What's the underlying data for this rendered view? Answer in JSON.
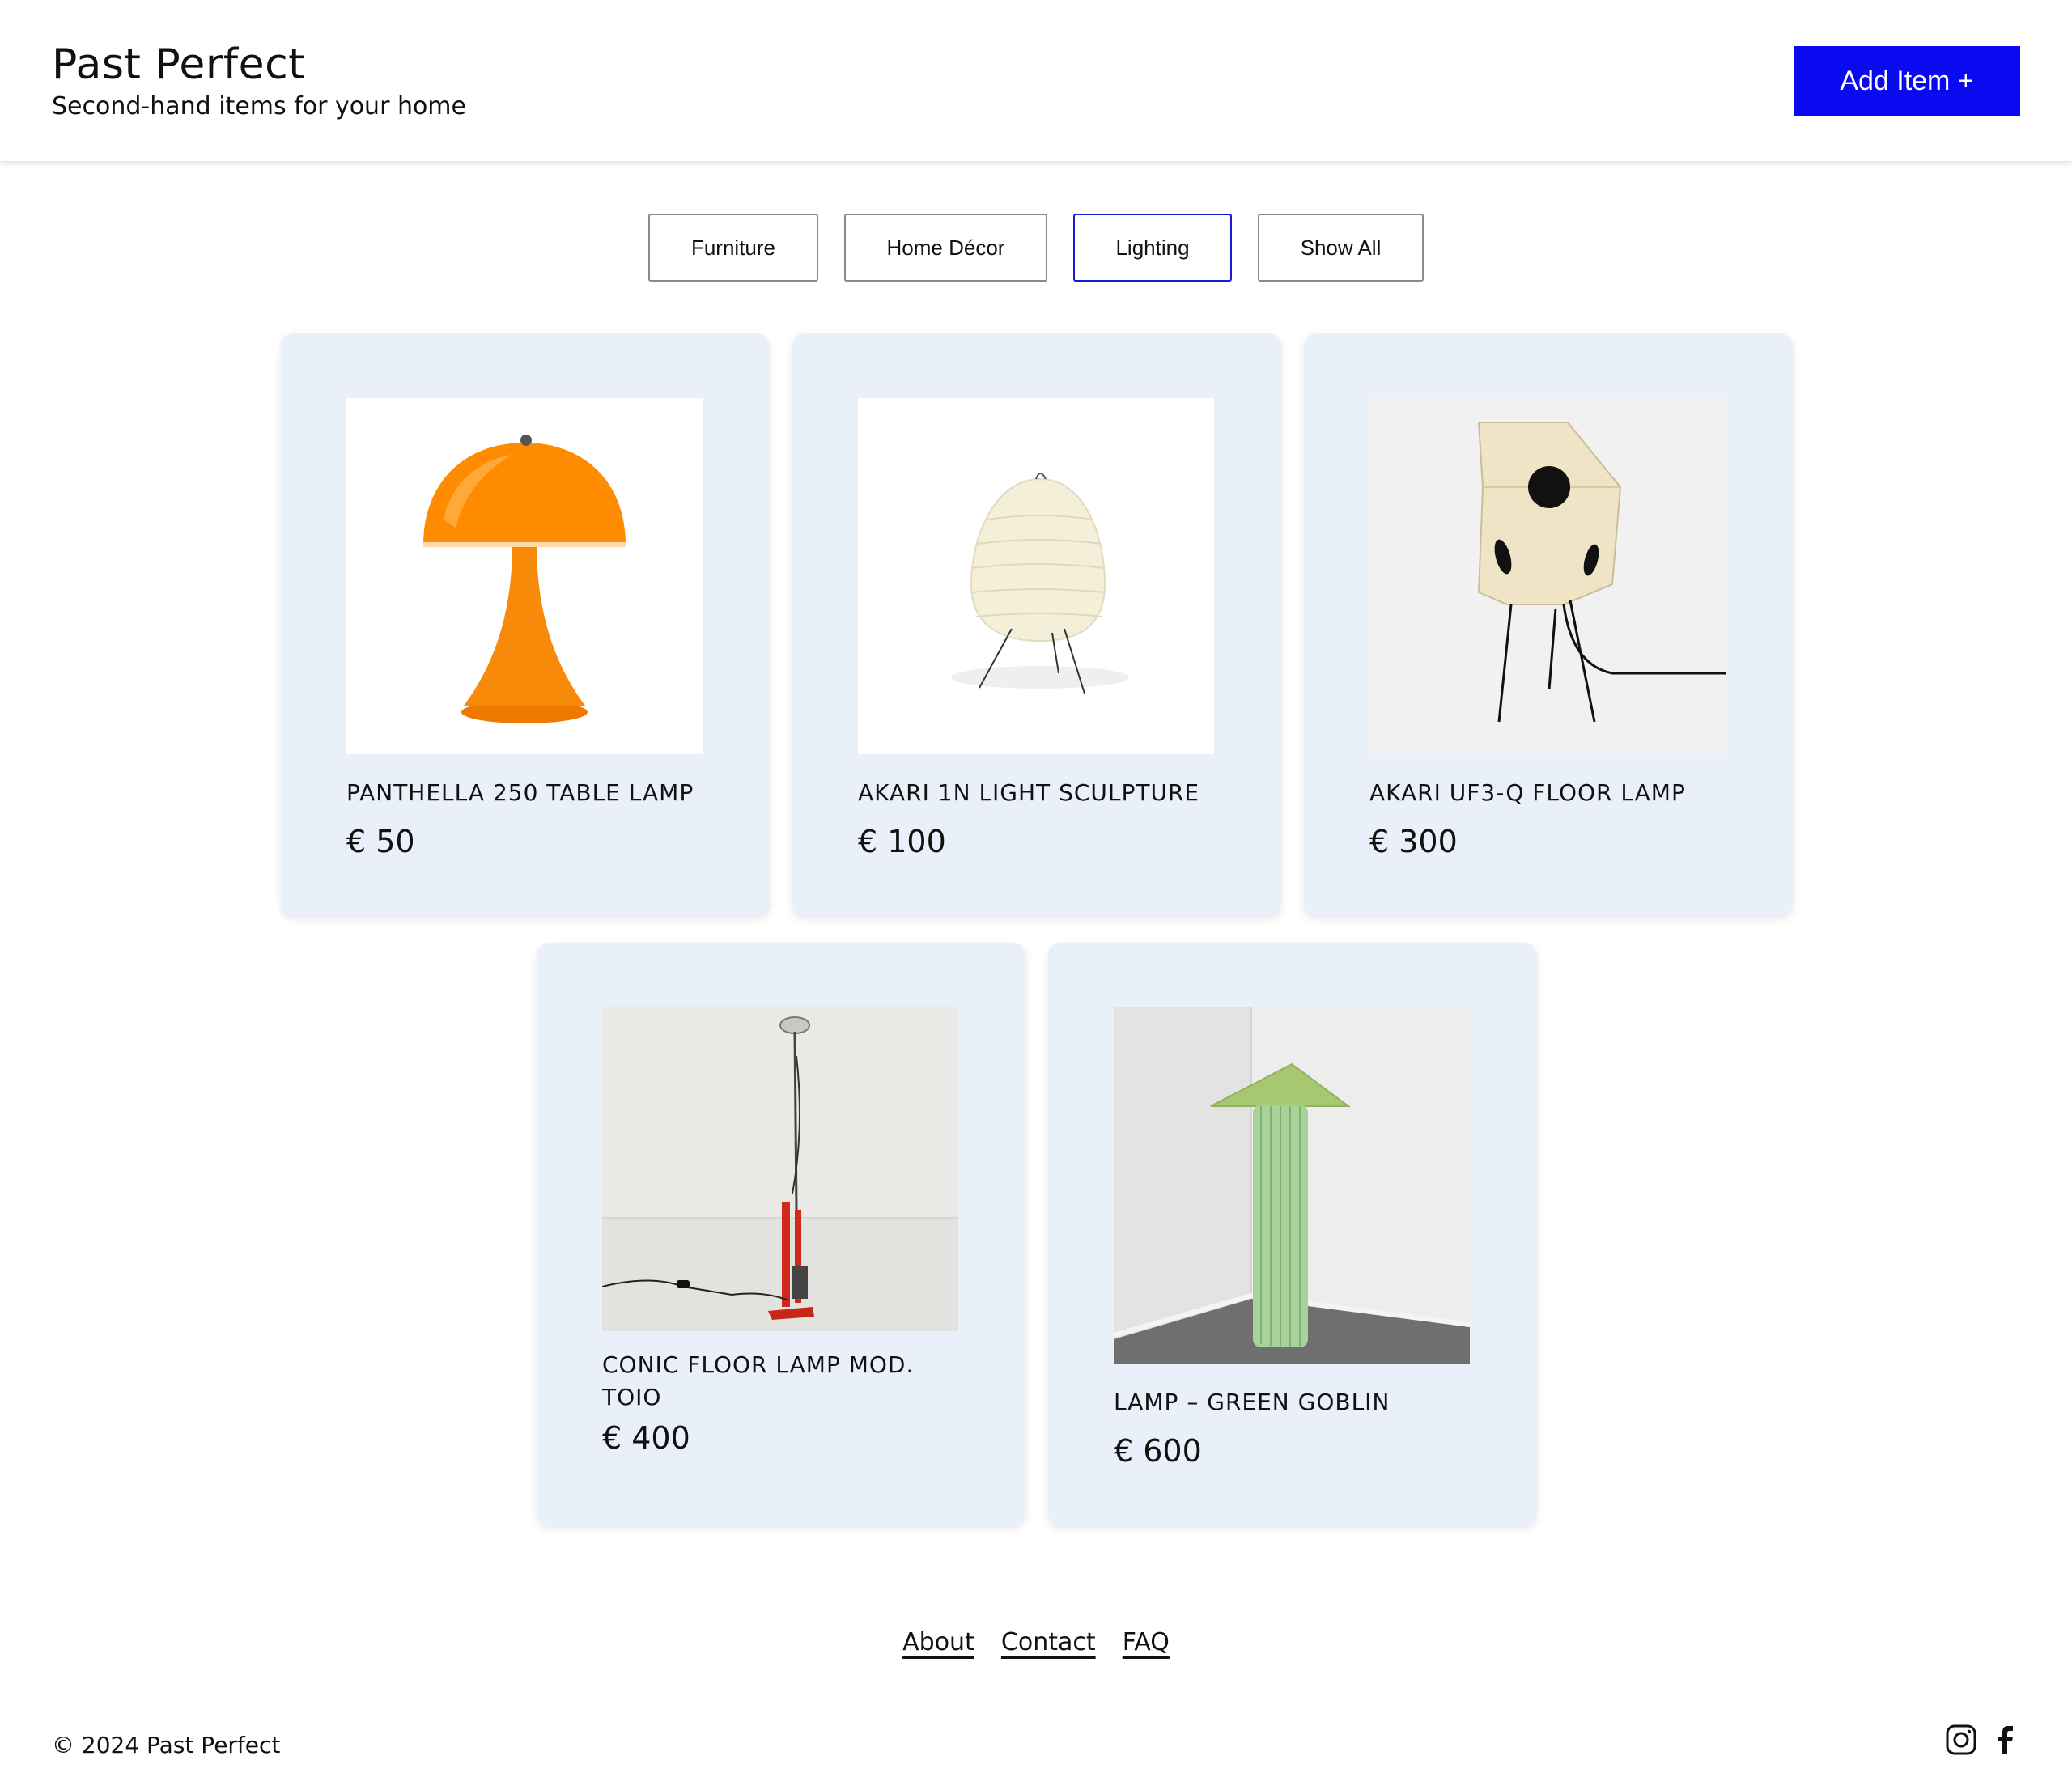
{
  "header": {
    "title": "Past Perfect",
    "tagline": "Second-hand items for your home",
    "add_button": "Add Item +"
  },
  "filters": [
    {
      "label": "Furniture",
      "active": false
    },
    {
      "label": "Home Décor",
      "active": false
    },
    {
      "label": "Lighting",
      "active": true
    },
    {
      "label": "Show All",
      "active": false
    }
  ],
  "products": [
    {
      "name": "PANTHELLA 250 TABLE LAMP",
      "price": "€ 50"
    },
    {
      "name": "AKARI 1N LIGHT SCULPTURE",
      "price": "€ 100"
    },
    {
      "name": "AKARI UF3-Q FLOOR LAMP",
      "price": "€ 300"
    },
    {
      "name": "CONIC FLOOR LAMP MOD. TOIO",
      "price": "€ 400"
    },
    {
      "name": "LAMP – GREEN GOBLIN",
      "price": "€ 600"
    }
  ],
  "footer": {
    "links": [
      "About",
      "Contact",
      "FAQ"
    ],
    "copyright": "© 2024 Past Perfect",
    "social": [
      "instagram-icon",
      "facebook-icon"
    ]
  },
  "colors": {
    "accent": "#0a0af0",
    "card_bg": "#e9f0fa",
    "active_filter_border": "#1a1ad6"
  }
}
